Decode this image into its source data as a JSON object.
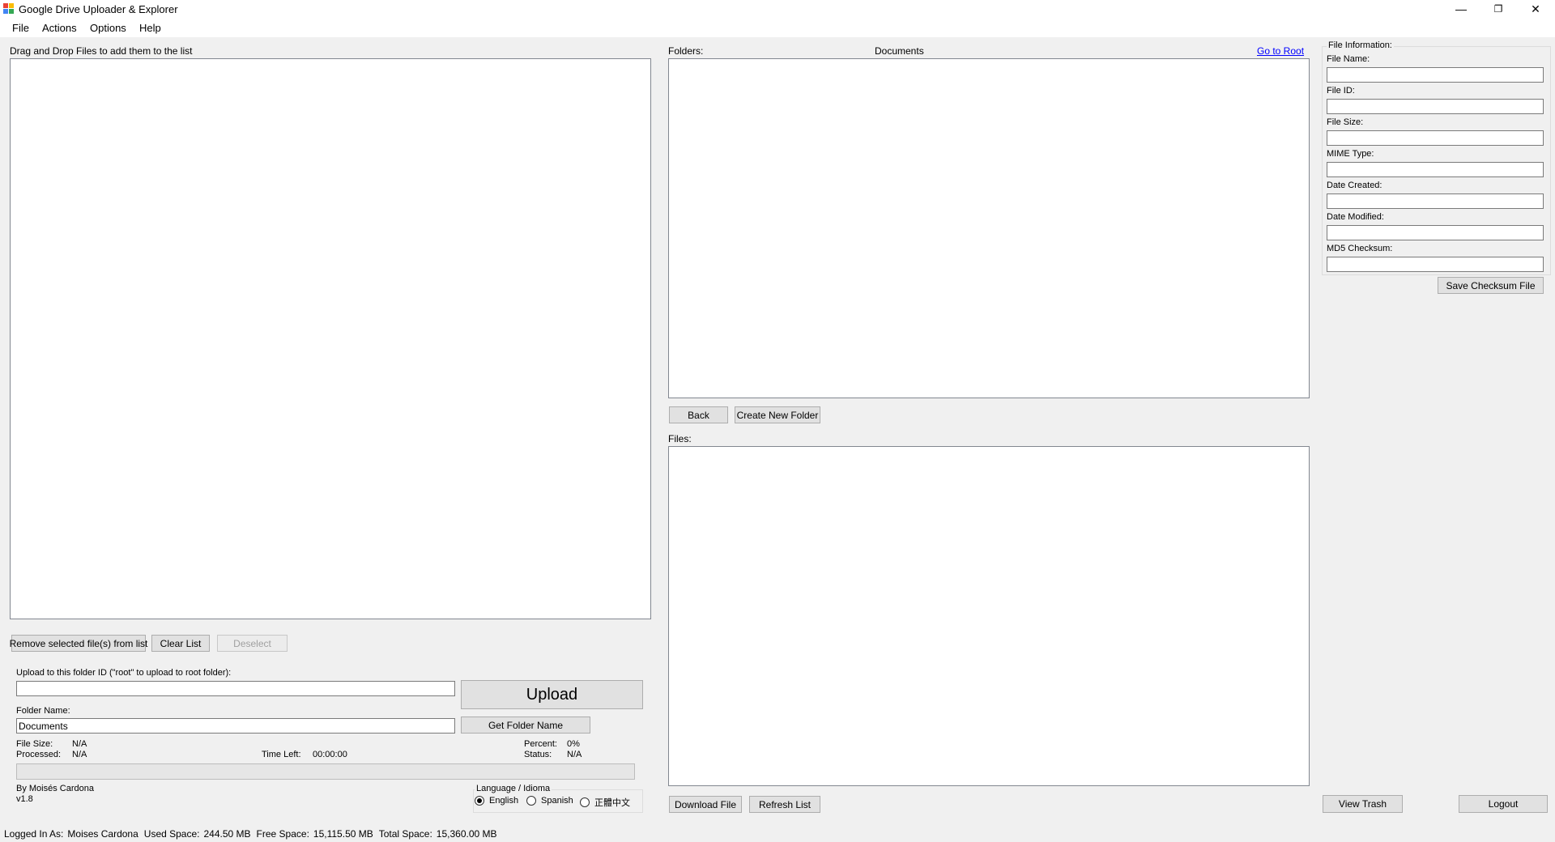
{
  "window": {
    "title": "Google Drive Uploader & Explorer",
    "minimize": "—",
    "maximize": "❐",
    "close": "✕"
  },
  "menu": [
    "File",
    "Actions",
    "Options",
    "Help"
  ],
  "left": {
    "drop_label": "Drag and Drop Files to add them to the list",
    "remove_btn": "Remove selected file(s) from list",
    "clear_btn": "Clear List",
    "deselect_btn": "Deselect",
    "upload_label": "Upload to this folder ID (\"root\" to upload to root folder):",
    "folder_id_value": "",
    "upload_btn": "Upload",
    "folder_name_label": "Folder Name:",
    "folder_name_value": "Documents",
    "get_folder_btn": "Get Folder Name",
    "file_size_label": "File Size:",
    "file_size_value": "N/A",
    "processed_label": "Processed:",
    "processed_value": "N/A",
    "time_left_label": "Time Left:",
    "time_left_value": "00:00:00",
    "percent_label": "Percent:",
    "percent_value": "0%",
    "status_label": "Status:",
    "status_value": "N/A",
    "progress_fraction": 0,
    "author": "By Moisés Cardona",
    "version": "v1.8",
    "language": {
      "title": "Language / Idioma",
      "options": [
        "English",
        "Spanish",
        "正體中文"
      ],
      "selected": 0
    }
  },
  "middle": {
    "folders_label": "Folders:",
    "current_folder": "Documents",
    "go_root": "Go to Root",
    "back_btn": "Back",
    "create_folder_btn": "Create New Folder",
    "files_label": "Files:",
    "download_btn": "Download File",
    "refresh_btn": "Refresh List"
  },
  "info": {
    "title": "File Information:",
    "file_name_label": "File Name:",
    "file_id_label": "File ID:",
    "file_size_label": "File Size:",
    "mime_label": "MIME Type:",
    "created_label": "Date Created:",
    "modified_label": "Date Modified:",
    "md5_label": "MD5 Checksum:",
    "save_checksum_btn": "Save Checksum File",
    "view_trash_btn": "View Trash",
    "logout_btn": "Logout"
  },
  "status": {
    "logged_label": "Logged In As:",
    "logged_value": "Moises Cardona",
    "used_label": "Used Space:",
    "used_value": "244.50 MB",
    "free_label": "Free Space:",
    "free_value": "15,115.50 MB",
    "total_label": "Total Space:",
    "total_value": "15,360.00 MB"
  }
}
